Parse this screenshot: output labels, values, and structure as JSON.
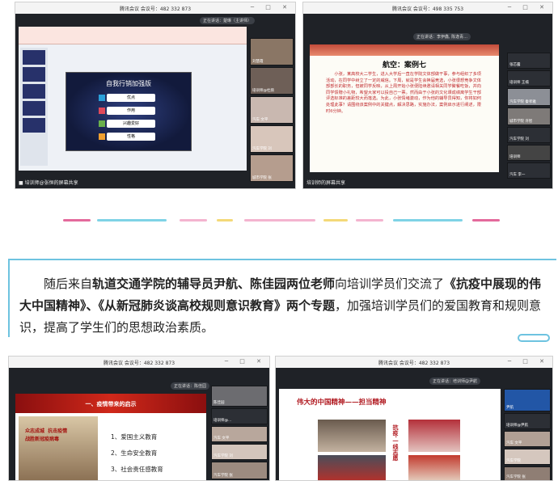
{
  "shot1": {
    "title": "腾讯会议 会议号：482 332 873",
    "speaker": "正在讲话：楚琳（主讲师）",
    "slide_title": "自我行销加强版",
    "slide_items": [
      "优点",
      "作用",
      "兴趣爱好",
      "性格"
    ],
    "footer": "■ 培训师@张恒的屏幕共享",
    "participants": [
      "刘慧霞",
      "培训师@杜鹃",
      "汽车 文平",
      "汽车学院 刘",
      "城市学院 张"
    ]
  },
  "shot2": {
    "title": "腾讯会议 会议号：498 335 753",
    "speaker": "正在讲话：李伊鑫, 陈逸青...",
    "slide_title": "航空：案例七",
    "slide_text": "小张，某高校大二学生，进入大学后一直在学院文体部做干事，参与组织了多项活动，在同学中树立了一定的威信。下周，就是学生会换届竞选，小张很想竞争文体部部长的职务，但被同学反映，从上周开始小张便陆续邀请相关同学聚餐吃饭，并向同学馈赠小礼物，希望大家可以投自己一票。然而由于小张的文化课成绩离学生干部评选标准的差距较大而落选。为此，小张情绪激动，作为他的辅导员得知，你将如何处理此事？请围绕该案例中的关键点，解决思路，实施办法，案例启示进行阐述，限时6分钟。",
    "footer": "培训师的屏幕共享",
    "participants": [
      "张芯露",
      "培训师 王楠",
      "汽车学院 秦孝雅",
      "城市学院 许智",
      "汽车学院 刘",
      "培训师",
      "汽车 李一"
    ]
  },
  "paragraph": {
    "part1": "随后来自",
    "bold1": "轨道交通学院的辅导员尹航、陈佳园两位老师",
    "part2": "向培训学员们交流了",
    "bold2": "《抗疫中展现的伟大中国精神》、《从新冠肺炎谈高校规则意识教育》两个专题",
    "part3": "，加强培训学员们的爱国教育和规则意识，提高了学生们的思想政治素质。"
  },
  "shot3": {
    "title": "腾讯会议 会议号：482 332 873",
    "speaker": "正在讲话：陈佳园",
    "slide_title": "一、疫情带来的启示",
    "slide_items": [
      "1、爱国主义教育",
      "2、生命安全教育",
      "3、社会责任感教育"
    ],
    "poster_text": "众志成城  抗击疫情\n战胜新冠疫病毒",
    "participants": [
      "陈佳园",
      "培训师@...",
      "汽车 文平",
      "汽车学院 刘",
      "汽车学院 张"
    ]
  },
  "shot4": {
    "title": "腾讯会议 会议号：482 332 873",
    "speaker": "正在讲话：培训师@尹航",
    "slide_title": "伟大的中国精神——担当精神",
    "slide_side_text": "抗疫·一线志愿",
    "participants": [
      "尹航",
      "培训师@尹航",
      "汽车 文平",
      "汽车学院",
      "汽车学院 张"
    ]
  },
  "colors": {
    "accent_blue": "#6ec3e0",
    "deco_pink": "#e46a9c",
    "deco_cyan": "#7fd3e6",
    "deco_yellow": "#f4d978"
  }
}
